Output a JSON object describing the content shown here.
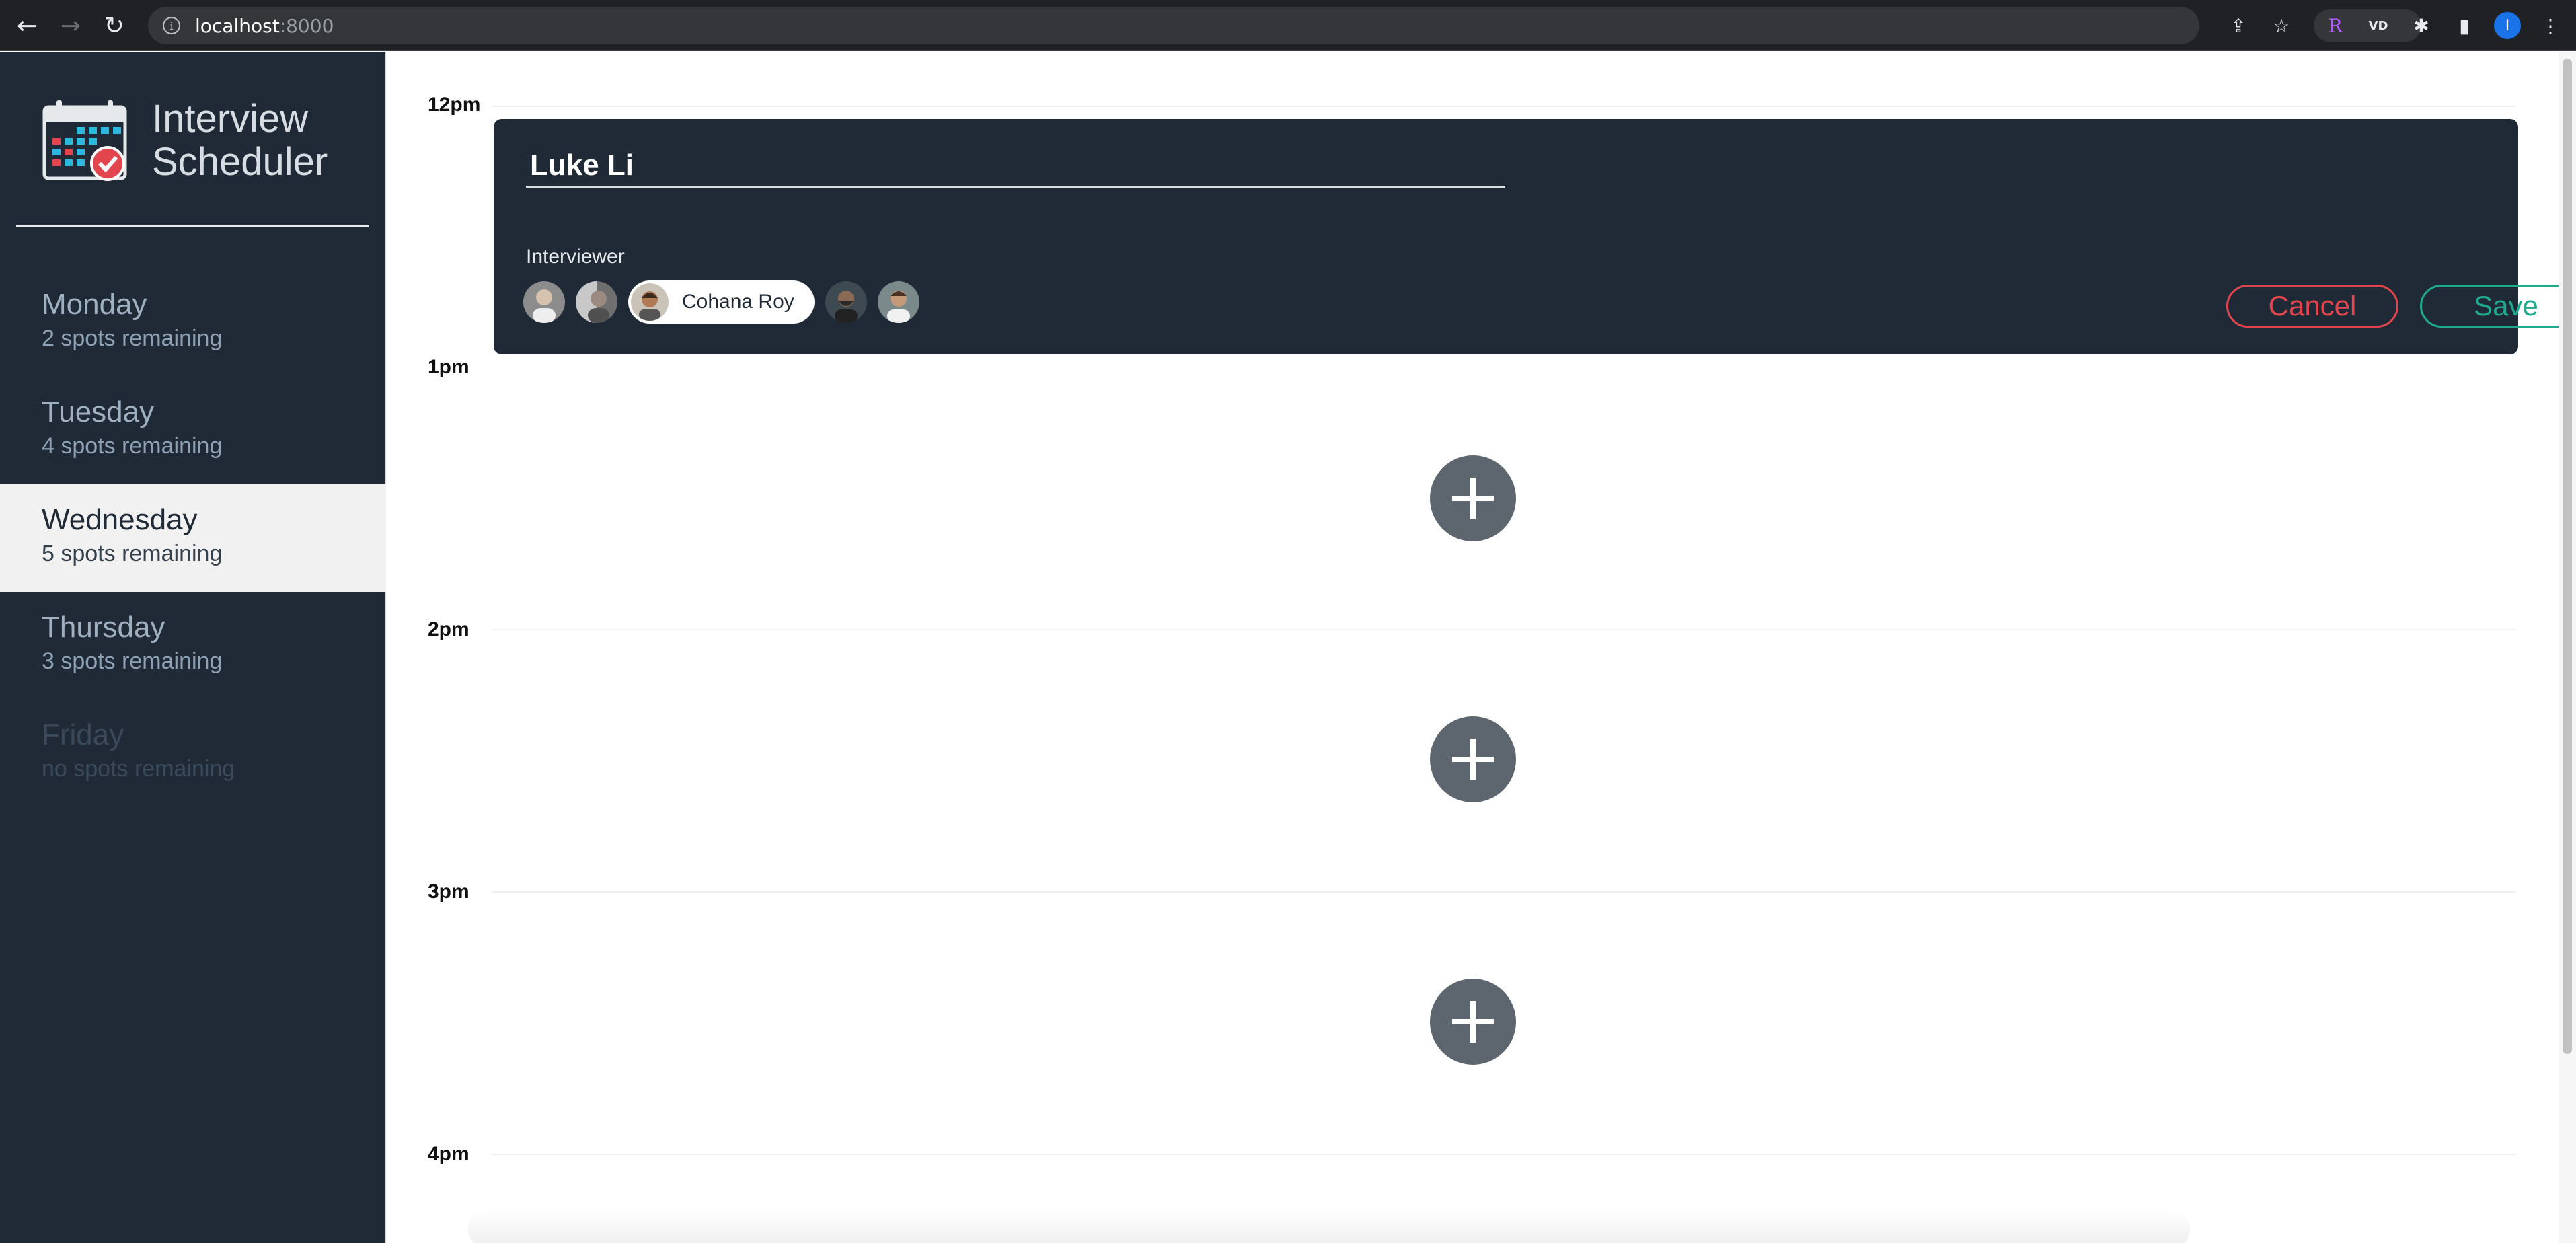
{
  "browser": {
    "url_host": "localhost",
    "url_port": ":8000",
    "profile_initial": "I",
    "extensions": [
      "R",
      "VD"
    ]
  },
  "sidebar": {
    "brand_line1": "Interview",
    "brand_line2": "Scheduler",
    "days": [
      {
        "name": "Monday",
        "spots": "2 spots remaining",
        "state": "normal"
      },
      {
        "name": "Tuesday",
        "spots": "4 spots remaining",
        "state": "normal"
      },
      {
        "name": "Wednesday",
        "spots": "5 spots remaining",
        "state": "selected"
      },
      {
        "name": "Thursday",
        "spots": "3 spots remaining",
        "state": "normal"
      },
      {
        "name": "Friday",
        "spots": "no spots remaining",
        "state": "full"
      }
    ]
  },
  "schedule": {
    "hours": [
      "12pm",
      "1pm",
      "2pm",
      "3pm",
      "4pm"
    ],
    "form": {
      "student_name": "Luke Li",
      "interviewer_label": "Interviewer",
      "selected_interviewer": "Cohana Roy",
      "cancel_label": "Cancel",
      "save_label": "Save"
    }
  },
  "colors": {
    "sidebar_bg": "#1f2a36",
    "cancel": "#e2454d",
    "save": "#1eaa8c",
    "add_button": "#5d666e"
  }
}
